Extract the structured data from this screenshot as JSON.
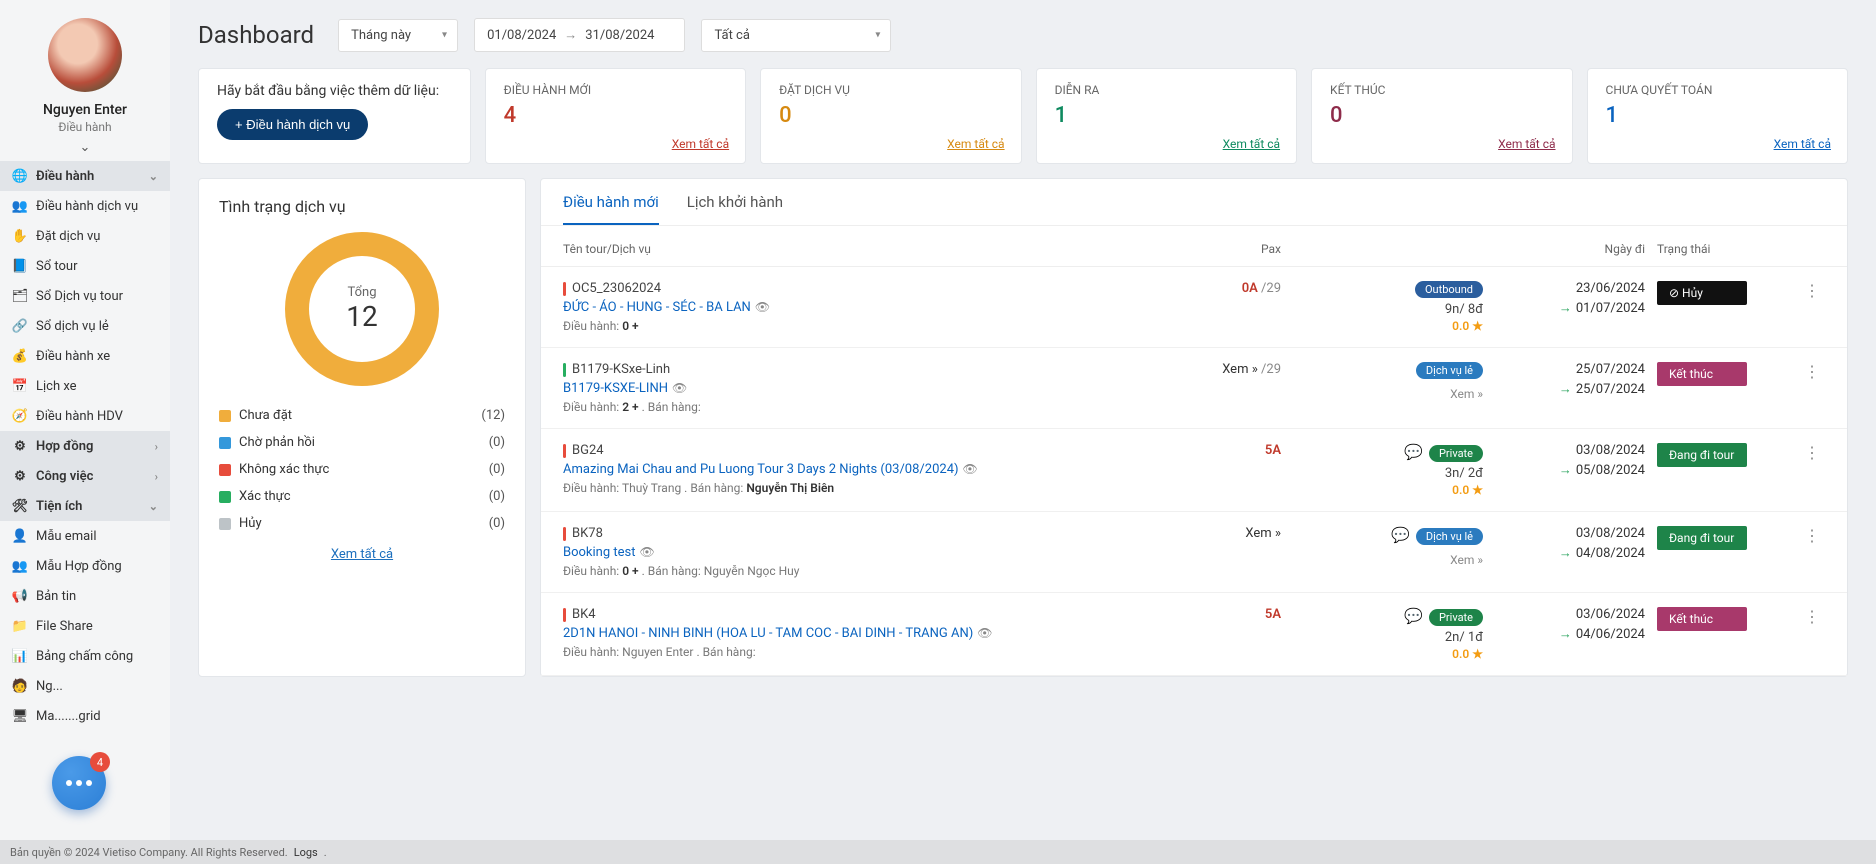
{
  "user": {
    "name": "Nguyen Enter",
    "role": "Điều hành"
  },
  "sidebar": {
    "sections": [
      {
        "label": "Điều hành",
        "expanded": true,
        "icon": "🌐",
        "items": [
          {
            "label": "Điều hành dịch vụ",
            "icon": "👥"
          },
          {
            "label": "Đặt dịch vụ",
            "icon": "✋"
          },
          {
            "label": "Sổ tour",
            "icon": "📘"
          },
          {
            "label": "Sổ Dịch vụ tour",
            "icon": "🗂"
          },
          {
            "label": "Sổ dịch vụ lẻ",
            "icon": "🔗"
          },
          {
            "label": "Điều hành xe",
            "icon": "💰"
          },
          {
            "label": "Lịch xe",
            "icon": "📅"
          },
          {
            "label": "Điều hành HDV",
            "icon": "🧭"
          }
        ]
      },
      {
        "label": "Hợp đồng",
        "icon": "⚙",
        "collapsed": true
      },
      {
        "label": "Công việc",
        "icon": "⚙",
        "collapsed": true
      },
      {
        "label": "Tiện ích",
        "icon": "🛠",
        "expanded": true,
        "items": [
          {
            "label": "Mẫu email",
            "icon": "👤"
          },
          {
            "label": "Mẫu Hợp đồng",
            "icon": "👥"
          },
          {
            "label": "Bản tin",
            "icon": "📢"
          },
          {
            "label": "File Share",
            "icon": "📁"
          },
          {
            "label": "Bảng chấm công",
            "icon": "📊"
          },
          {
            "label": "Ng...",
            "icon": "🧑"
          },
          {
            "label": "Ma.......grid",
            "icon": "🖥"
          }
        ]
      }
    ]
  },
  "topbar": {
    "title": "Dashboard",
    "period": "Tháng này",
    "date_from": "01/08/2024",
    "date_to": "31/08/2024",
    "filter": "Tất cả"
  },
  "start_card": {
    "text": "Hãy bắt đầu bằng việc thêm dữ liệu:",
    "button": "+ Điều hành dịch vụ"
  },
  "stats": {
    "view_all": "Xem tất cả",
    "items": [
      {
        "label": "ĐIỀU HÀNH MỚI",
        "value": "4",
        "color": "c-red"
      },
      {
        "label": "ĐẶT DỊCH VỤ",
        "value": "0",
        "color": "c-orange"
      },
      {
        "label": "DIỄN RA",
        "value": "1",
        "color": "c-green"
      },
      {
        "label": "KẾT THÚC",
        "value": "0",
        "color": "c-maroon"
      },
      {
        "label": "CHƯA QUYẾT TOÁN",
        "value": "1",
        "color": "c-blue"
      }
    ]
  },
  "status": {
    "title": "Tình trạng dịch vụ",
    "total_label": "Tổng",
    "total_value": "12",
    "link": "Xem tất cả",
    "legend": [
      {
        "label": "Chưa đặt",
        "count": "(12)",
        "color": "#f0ad3c"
      },
      {
        "label": "Chờ phản hồi",
        "count": "(0)",
        "color": "#3498db"
      },
      {
        "label": "Không xác thực",
        "count": "(0)",
        "color": "#e74c3c"
      },
      {
        "label": "Xác thực",
        "count": "(0)",
        "color": "#27ae60"
      },
      {
        "label": "Hủy",
        "count": "(0)",
        "color": "#bdc3c7"
      }
    ]
  },
  "tabs": {
    "t0": "Điều hành mới",
    "t1": "Lịch khởi hành"
  },
  "table": {
    "headers": {
      "name": "Tên tour/Dịch vụ",
      "pax": "Pax",
      "date": "Ngày đi",
      "status": "Trạng thái"
    },
    "rows": [
      {
        "bar": "bar-red",
        "code": "OC5_23062024",
        "link": "ĐỨC - ÁO - HUNG - SÉC - BA LAN",
        "meta_pre": "Điều hành: ",
        "meta_b": "0 + ",
        "meta_post": "",
        "pax_a": "0A",
        "pax_total": " /29",
        "badge": "Outbound",
        "badge_cls": "bg-outbound",
        "nights": "9n/ 8đ",
        "score": "0.0",
        "date1": "23/06/2024",
        "date2": "01/07/2024",
        "status": "⊘ Hủy",
        "status_cls": "st-huy",
        "show_chat": false,
        "xem_top": "",
        "xem_bottom": ""
      },
      {
        "bar": "bar-green",
        "code": "B1179-KSxe-Linh",
        "link": "B1179-KSXE-LINH",
        "meta_pre": "Điều hành: ",
        "meta_b": "2 + ",
        "meta_post": ". Bán hàng:",
        "xem_top": "Xem »",
        "pax_total": " /29",
        "badge": "Dịch vụ lẻ",
        "badge_cls": "bg-dvle",
        "nights": "",
        "score": "",
        "xem_bottom": "Xem »",
        "date1": "25/07/2024",
        "date2": "25/07/2024",
        "status": "Kết thúc",
        "status_cls": "st-ketthuc",
        "show_chat": false,
        "pax_a": ""
      },
      {
        "bar": "bar-red",
        "code": "BG24",
        "link": "Amazing Mai Chau and Pu Luong Tour 3 Days 2 Nights (03/08/2024)",
        "meta_pre": "Điều hành: Thuỳ Trang . Bán hàng: ",
        "meta_b": "Nguyễn Thị Biên",
        "meta_post": "",
        "pax_a": "5A",
        "pax_total": "",
        "badge": "Private",
        "badge_cls": "bg-private",
        "nights": "3n/ 2đ",
        "score": "0.0",
        "date1": "03/08/2024",
        "date2": "05/08/2024",
        "status": "Đang đi tour",
        "status_cls": "st-dang",
        "show_chat": true,
        "xem_top": "",
        "xem_bottom": ""
      },
      {
        "bar": "bar-red",
        "code": "BK78",
        "link": "Booking test",
        "meta_pre": "Điều hành: ",
        "meta_b": "0 + ",
        "meta_post": ". Bán hàng: Nguyễn Ngọc Huy",
        "xem_top": "Xem »",
        "pax_total": "",
        "badge": "Dịch vụ lẻ",
        "badge_cls": "bg-dvle",
        "nights": "",
        "score": "",
        "xem_bottom": "Xem »",
        "date1": "03/08/2024",
        "date2": "04/08/2024",
        "status": "Đang đi tour",
        "status_cls": "st-dang",
        "show_chat": true,
        "pax_a": ""
      },
      {
        "bar": "bar-red",
        "code": "BK4",
        "link": "2D1N HANOI - NINH BINH (HOA LU - TAM COC - BAI DINH - TRANG AN)",
        "meta_pre": "Điều hành: Nguyen Enter . Bán hàng:",
        "meta_b": "",
        "meta_post": "",
        "pax_a": "5A",
        "pax_total": "",
        "badge": "Private",
        "badge_cls": "bg-private",
        "nights": "2n/ 1đ",
        "score": "0.0",
        "date1": "03/06/2024",
        "date2": "04/06/2024",
        "status": "Kết thúc",
        "status_cls": "st-ketthuc",
        "show_chat": true,
        "xem_top": "",
        "xem_bottom": ""
      }
    ]
  },
  "chat": {
    "badge": "4"
  },
  "footer": {
    "copyright": "Bản quyền © 2024 Vietiso Company. All Rights Reserved.",
    "logs": "Logs"
  }
}
